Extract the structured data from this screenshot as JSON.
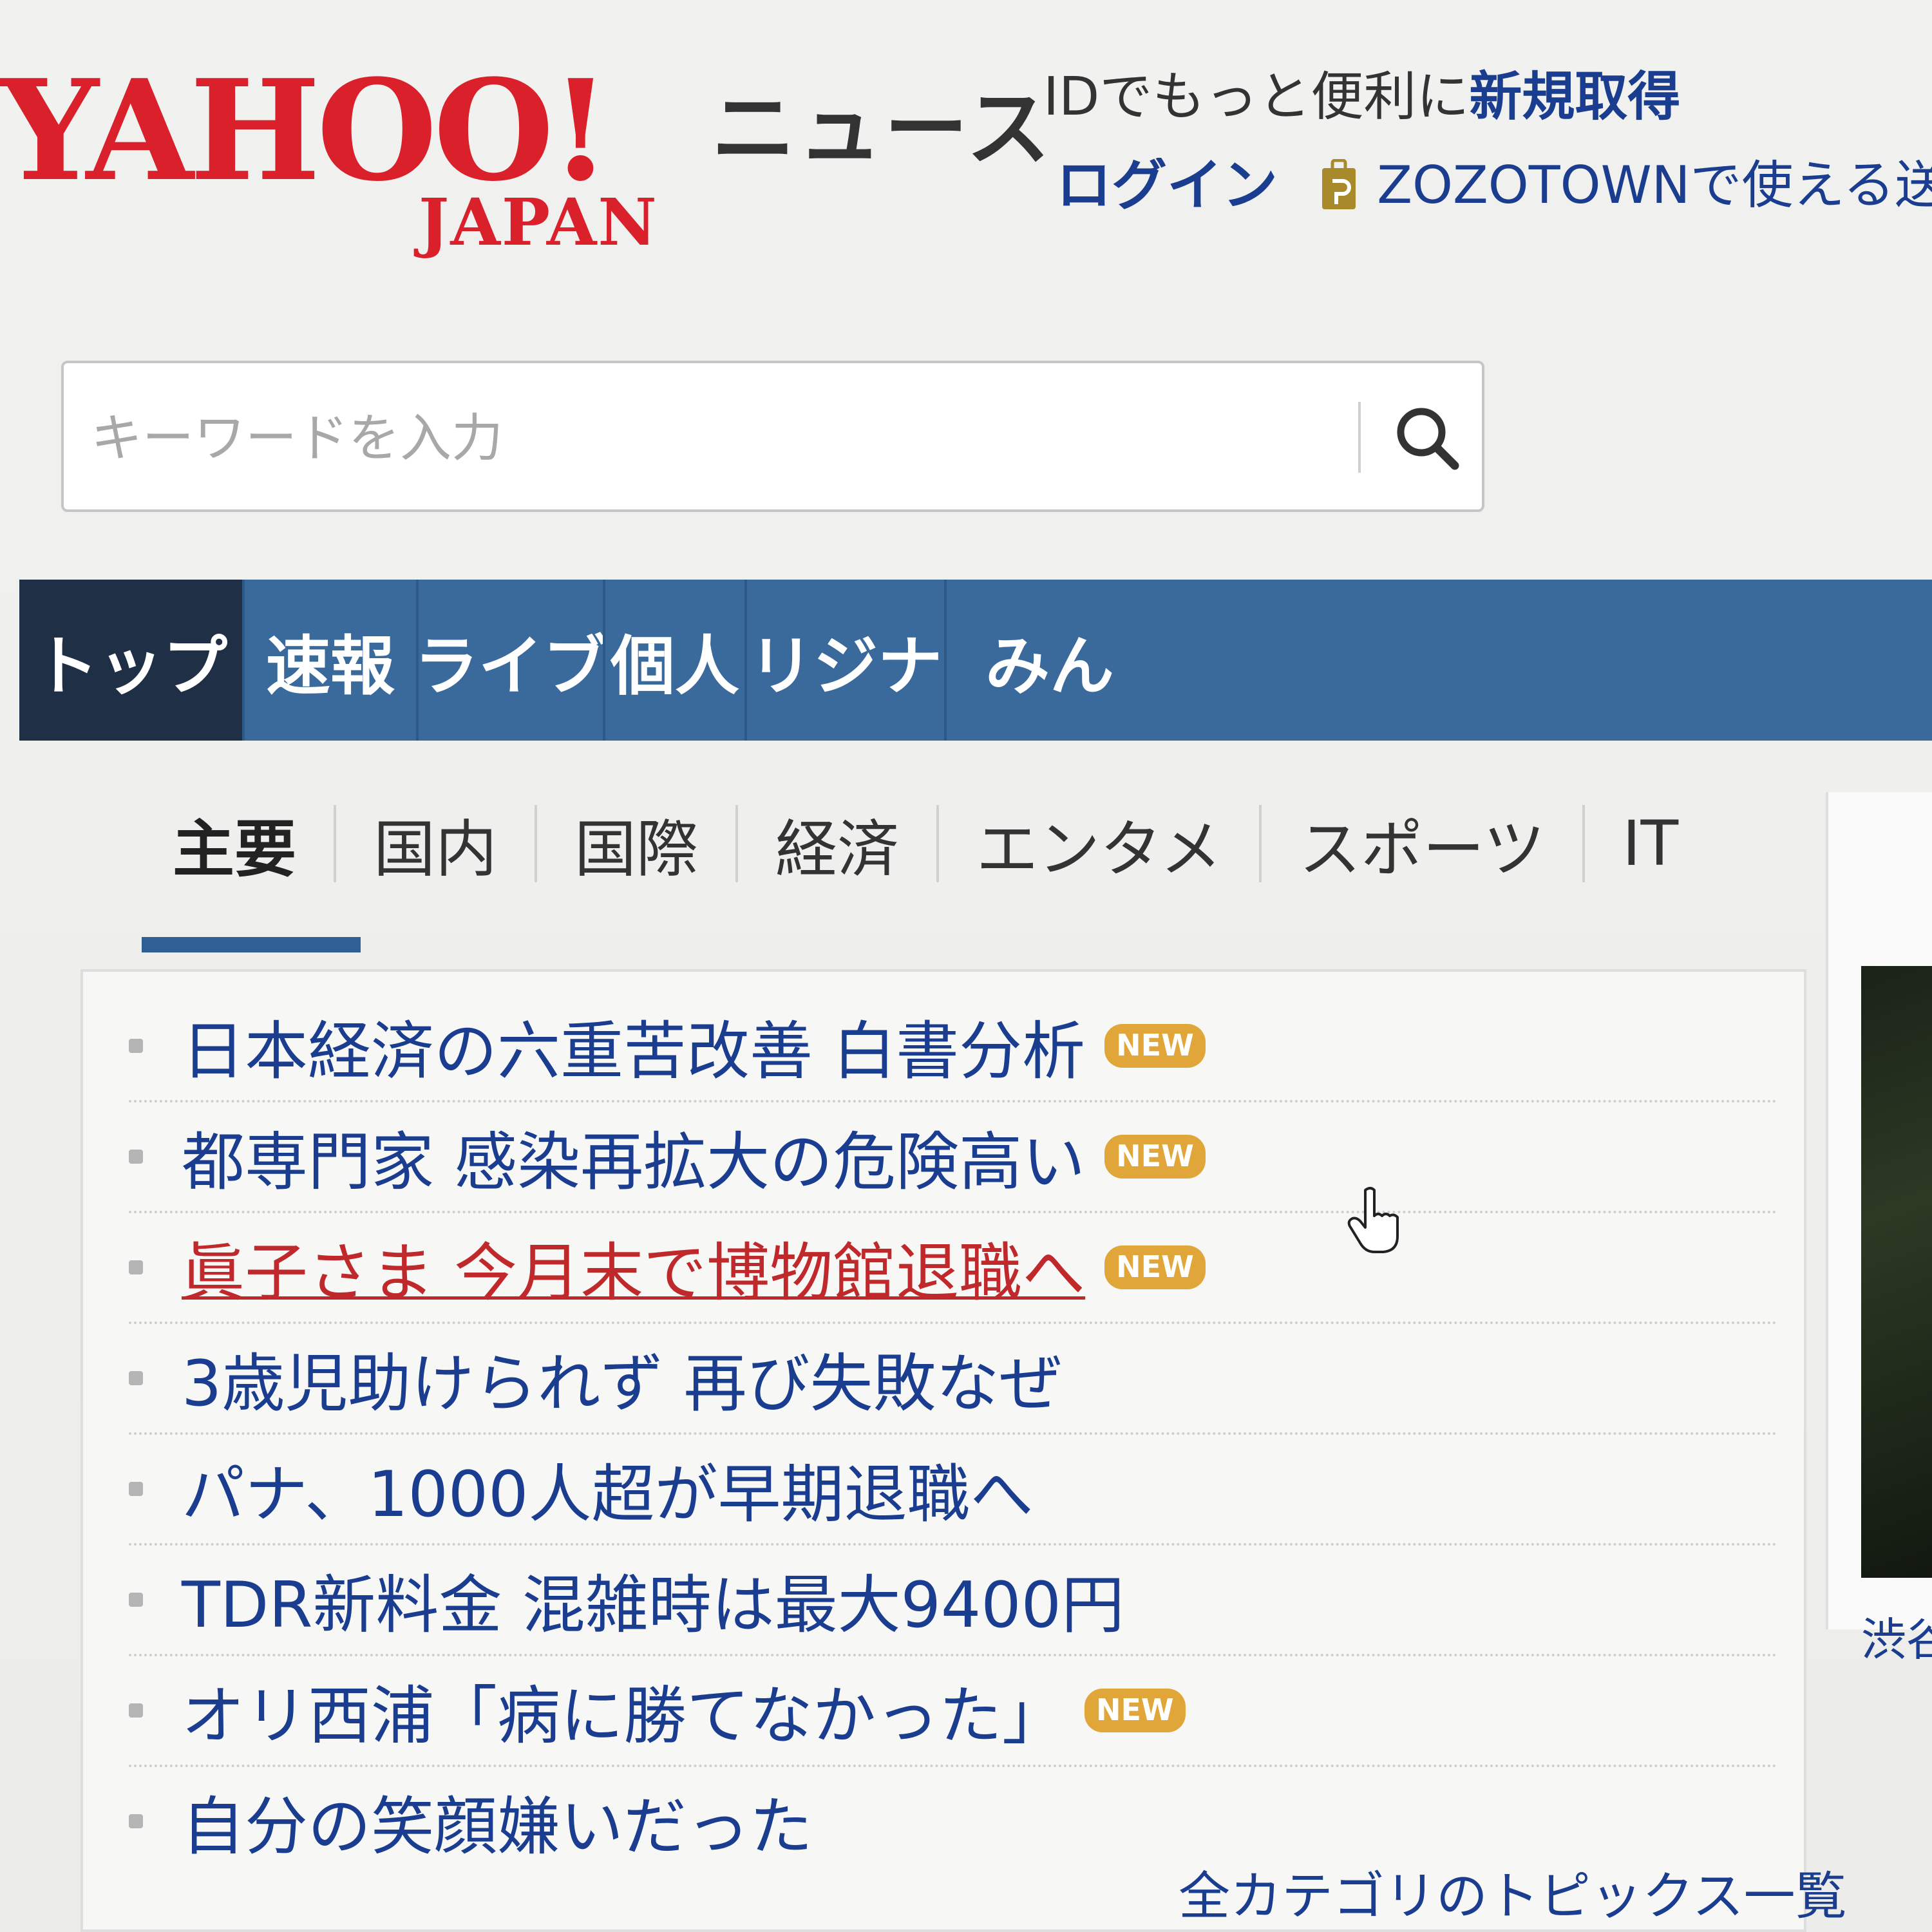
{
  "brand": {
    "logo_main": "YAHOO!",
    "logo_sub": "JAPAN",
    "service": "ニュース"
  },
  "header": {
    "id_text": "IDでもっと便利に",
    "id_link": "新規取得",
    "login": "ログイン",
    "promo": "ZOZOTOWNで使える送料分"
  },
  "search": {
    "placeholder": "キーワードを入力"
  },
  "main_nav": {
    "tabs": [
      {
        "label": "トップ",
        "active": true
      },
      {
        "label": "速報"
      },
      {
        "label": "ライブ"
      },
      {
        "label": "個人"
      },
      {
        "label": "オリジナル"
      },
      {
        "label": "みん"
      }
    ]
  },
  "sub_nav": {
    "tabs": [
      {
        "label": "主要",
        "active": true
      },
      {
        "label": "国内"
      },
      {
        "label": "国際"
      },
      {
        "label": "経済"
      },
      {
        "label": "エンタメ"
      },
      {
        "label": "スポーツ"
      },
      {
        "label": "IT"
      }
    ]
  },
  "headlines": [
    {
      "text": "日本経済の六重苦改善 白書分析",
      "new": "NEW"
    },
    {
      "text": "都専門家 感染再拡大の危険高い",
      "new": "NEW"
    },
    {
      "text": "眞子さま 今月末で博物館退職へ",
      "new": "NEW",
      "visited": true
    },
    {
      "text": "3歳児助けられず 再び失敗なぜ"
    },
    {
      "text": "パナ、1000人超が早期退職へ"
    },
    {
      "text": "TDR新料金 混雑時は最大9400円"
    },
    {
      "text": "オリ西浦「病に勝てなかった」",
      "new": "NEW"
    },
    {
      "text": "自分の笑顔嫌いだった"
    }
  ],
  "all_topics_link": "全カテゴリのトピックス一覧",
  "side": {
    "caption": "渋谷"
  },
  "colors": {
    "brand_red": "#d9202b",
    "link_blue": "#1a3d8f",
    "nav_blue": "#3a6a9c",
    "nav_active": "#1f2f45",
    "visited_red": "#c0292c",
    "new_badge": "#e0a63a"
  },
  "icons": {
    "search": "search-icon",
    "promo": "zozo-tag-icon",
    "cursor": "hand-pointer-icon"
  }
}
